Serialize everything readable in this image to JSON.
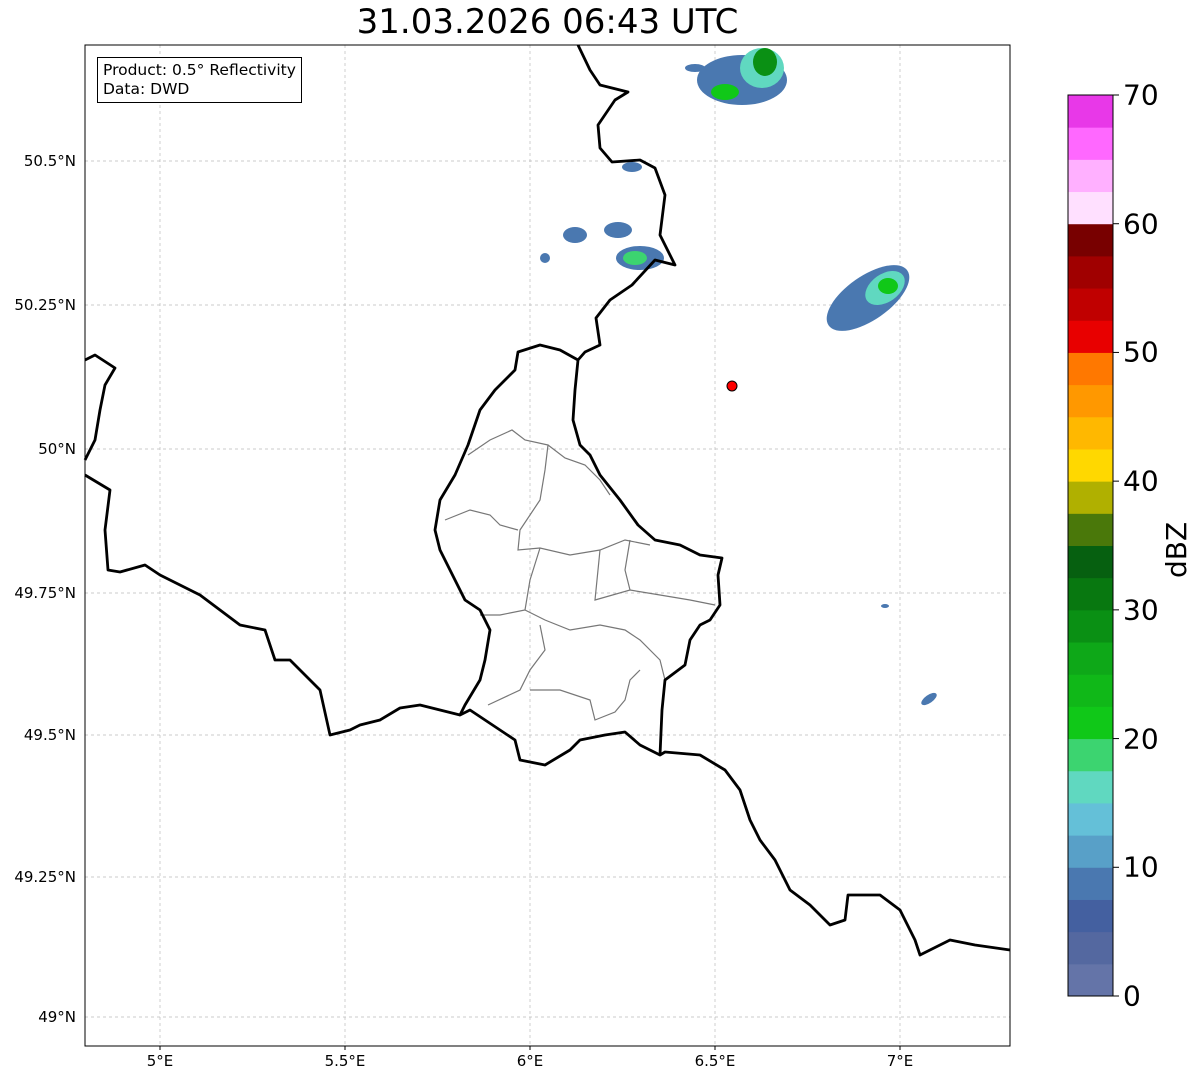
{
  "title": "31.03.2026 06:43 UTC",
  "info": {
    "line1": "Product: 0.5° Reflectivity",
    "line2": "Data: DWD"
  },
  "lat_labels": [
    "50.5°N",
    "50.25°N",
    "50°N",
    "49.75°N",
    "49.5°N",
    "49.25°N",
    "49°N"
  ],
  "lon_labels": [
    "5°E",
    "5.5°E",
    "6°E",
    "6.5°E",
    "7°E"
  ],
  "colorbar": {
    "label": "dBZ",
    "ticks": [
      "0",
      "10",
      "20",
      "30",
      "40",
      "50",
      "60",
      "70"
    ],
    "colors": [
      "#6474a8",
      "#5468a0",
      "#4460a0",
      "#4a78b0",
      "#58a0c8",
      "#64c0d8",
      "#60d8c0",
      "#3cd470",
      "#10c818",
      "#10b818",
      "#0ea818",
      "#0a9014",
      "#087810",
      "#066010",
      "#4a780a",
      "#b0b000",
      "#ffd800",
      "#ffb800",
      "#ff9800",
      "#ff7800",
      "#e80000",
      "#c00000",
      "#a00000",
      "#780000",
      "#ffe0ff",
      "#ffb0ff",
      "#ff68ff",
      "#e838e8"
    ]
  },
  "marker_color": "#ff0000"
}
